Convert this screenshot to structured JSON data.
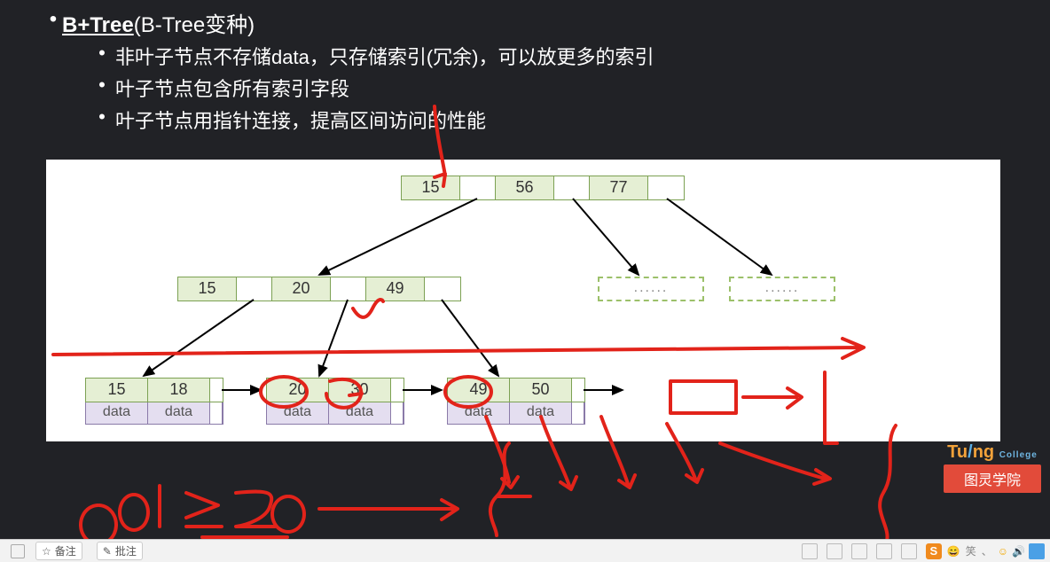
{
  "bullets": {
    "title_bold": "B+Tree",
    "title_rest": "(B-Tree变种)",
    "line1": "非叶子节点不存储data，只存储索引(冗余)，可以放更多的索引",
    "line2": "叶子节点包含所有索引字段",
    "line3": "叶子节点用指针连接，提高区间访问的性能"
  },
  "tree": {
    "root": [
      "15",
      "56",
      "77"
    ],
    "mid1": [
      "15",
      "20",
      "49"
    ],
    "leaves": [
      {
        "keys": [
          "15",
          "18"
        ],
        "data": [
          "data",
          "data"
        ]
      },
      {
        "keys": [
          "20",
          "30"
        ],
        "data": [
          "data",
          "data"
        ]
      },
      {
        "keys": [
          "49",
          "50"
        ],
        "data": [
          "data",
          "data"
        ]
      }
    ],
    "placeholder": "......"
  },
  "annotation": {
    "formula": "col ≥ 20"
  },
  "logo": {
    "brand_left": "Tu",
    "brand_right": "ng",
    "sub": "College",
    "caption": "图灵学院"
  },
  "taskbar": {
    "note_btn": "备注",
    "comment_btn": "批注",
    "ime": "S",
    "emoji_text": "笑"
  }
}
